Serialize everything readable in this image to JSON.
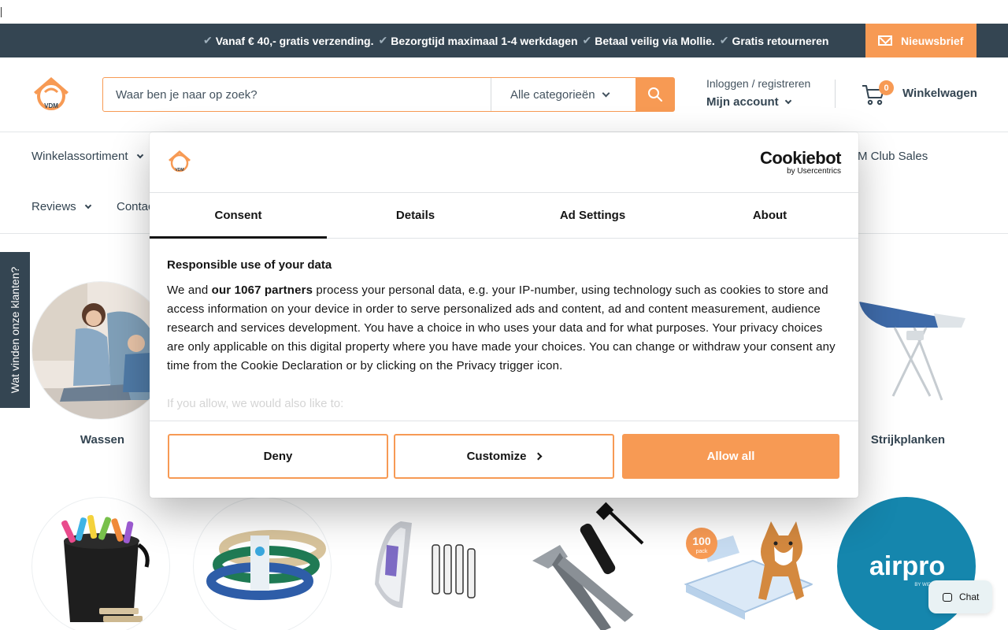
{
  "announcement": {
    "usps": [
      "Vanaf € 40,- gratis verzending.",
      "Bezorgtijd maximaal 1-4 werkdagen",
      "Betaal veilig via Mollie.",
      "Gratis retourneren"
    ],
    "check_glyph": "✔",
    "newsletter_label": "Nieuwsbrief"
  },
  "header": {
    "logo_text": "VDM",
    "search_placeholder": "Waar ben je naar op zoek?",
    "category_select": "Alle categorieën",
    "login_label": "Inloggen / registreren",
    "account_label": "Mijn account",
    "cart_count": "0",
    "cart_label": "Winkelwagen"
  },
  "nav": {
    "row1": [
      {
        "label": "Winkelassortiment"
      },
      {
        "label": "M Club Sales"
      }
    ],
    "row2": [
      {
        "label": "Reviews"
      },
      {
        "label": "Contac"
      }
    ]
  },
  "side_tab": "Wat vinden onze klanten?",
  "categories": {
    "row1": [
      {
        "label": "Wassen"
      },
      {
        "label": "Strijkplanken"
      }
    ],
    "row2_icons": [
      "wasknijpers-image",
      "waslijn-image",
      "strijkijzer-image",
      "tang-image",
      "puppy-pads-image",
      "airpro-logo"
    ]
  },
  "airpro": {
    "brand": "airpro",
    "sub": "BY WIDEX"
  },
  "puppy_badge": {
    "num": "100",
    "text": "pack"
  },
  "cookie": {
    "brand": "Cookiebot",
    "brand_sub": "by Usercentrics",
    "tabs": [
      {
        "label": "Consent"
      },
      {
        "label": "Details"
      },
      {
        "label": "Ad Settings"
      },
      {
        "label": "About"
      }
    ],
    "heading": "Responsible use of your data",
    "intro_prefix": "We and ",
    "partners": "our 1067 partners",
    "intro_rest": " process your personal data, e.g. your IP-number, using technology such as cookies to store and access information on your device in order to serve personalized ads and content, ad and content measurement, audience research and services development. You have a choice in who uses your data and for what purposes. Your privacy choices are only applicable on this digital property where you have made your choices. You can change or withdraw your consent any time from the Cookie Declaration or by clicking on the Privacy trigger icon.",
    "more": "If you allow, we would also like to:",
    "deny": "Deny",
    "customize": "Customize",
    "allow": "Allow all"
  },
  "chat_label": "Chat",
  "colors": {
    "accent": "#f79a54",
    "navy": "#344552"
  }
}
